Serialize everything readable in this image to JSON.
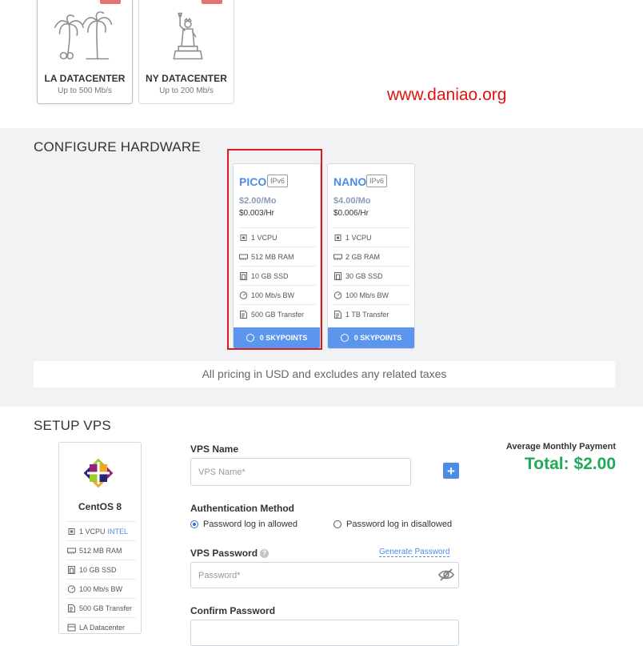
{
  "datacenters": [
    {
      "name": "LA DATACENTER",
      "speed": "Up to 500 Mb/s",
      "icon": "palm-trees-icon"
    },
    {
      "name": "NY DATACENTER",
      "speed": "Up to 200 Mb/s",
      "icon": "statue-of-liberty-icon"
    }
  ],
  "watermark": "www.daniao.org",
  "hardware": {
    "title": "CONFIGURE HARDWARE",
    "plans": [
      {
        "name": "PICO",
        "badge": "IPv6",
        "price_mo": "$2.00/Mo",
        "price_hr": "$0.003/Hr",
        "specs": [
          "1 VCPU",
          "512 MB RAM",
          "10 GB SSD",
          "100 Mb/s BW",
          "500 GB Transfer"
        ],
        "button": "0 SKYPOINTS",
        "selected": true
      },
      {
        "name": "NANO",
        "badge": "IPv6",
        "price_mo": "$4.00/Mo",
        "price_hr": "$0.006/Hr",
        "specs": [
          "1 VCPU",
          "2 GB RAM",
          "30 GB SSD",
          "100 Mb/s BW",
          "1 TB Transfer"
        ],
        "button": "0 SKYPOINTS",
        "selected": false
      }
    ],
    "tax_note": "All pricing in USD and excludes any related taxes"
  },
  "setup": {
    "title": "SETUP VPS",
    "os": {
      "name": "CentOS 8",
      "specs": [
        "1 VCPU",
        "512 MB RAM",
        "10 GB SSD",
        "100 Mb/s BW",
        "500 GB Transfer",
        "LA Datacenter"
      ],
      "cpu_brand": "INTEL"
    },
    "vps_name_label": "VPS Name",
    "vps_name_placeholder": "VPS Name*",
    "add_icon": "+",
    "auth_label": "Authentication Method",
    "auth_options": [
      "Password log in allowed",
      "Password log in disallowed"
    ],
    "auth_selected": 0,
    "password_label": "VPS Password",
    "help_icon": "?",
    "generate_label": "Generate Password",
    "password_placeholder": "Password*",
    "confirm_label": "Confirm Password",
    "avg_label": "Average Monthly Payment",
    "total": "Total: $2.00"
  },
  "colors": {
    "accent": "#4a8ce6",
    "button": "#5b95ed",
    "total": "#1faa58",
    "highlight": "#d71d1d",
    "watermark": "#e0130f"
  }
}
